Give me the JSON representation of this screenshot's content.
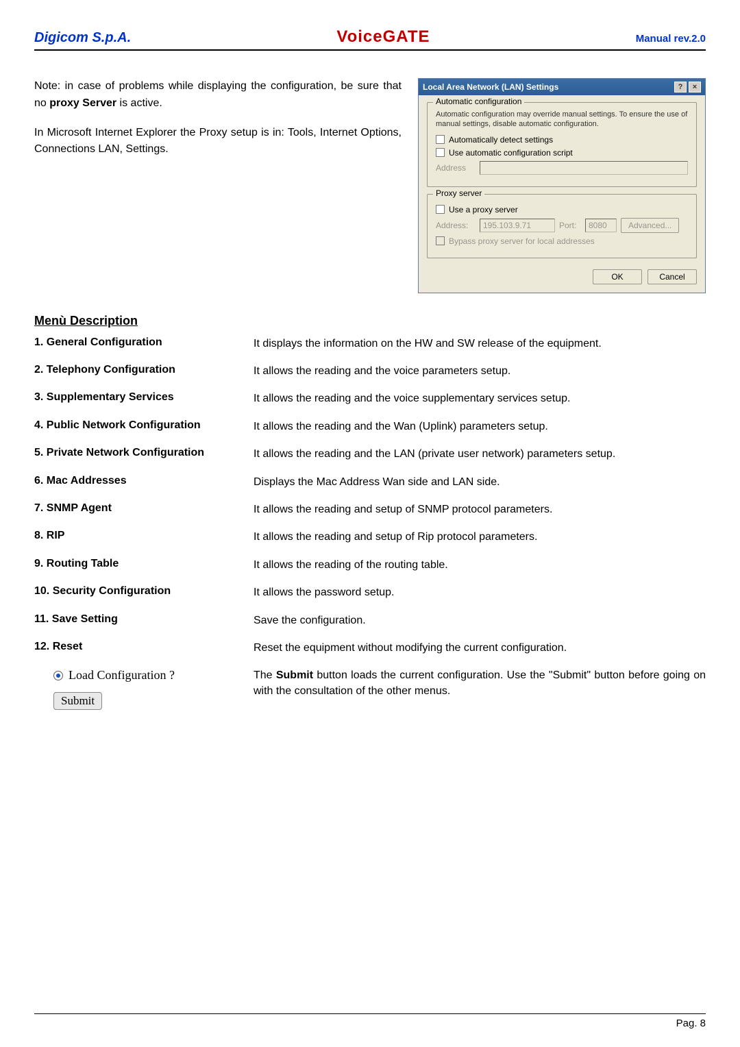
{
  "header": {
    "brand": "Digicom S.p.A.",
    "product": "VoiceGATE",
    "rev": "Manual rev.2.0"
  },
  "intro": {
    "p1_pre": "Note: in case of problems while displaying the configuration, be sure that no ",
    "p1_bold": "proxy Server",
    "p1_post": " is active.",
    "p2": "In Microsoft Internet Explorer the Proxy setup is in: Tools, Internet Options, Connections LAN, Settings."
  },
  "dialog": {
    "title": "Local Area Network (LAN) Settings",
    "help_icon": "?",
    "close_icon": "×",
    "group1": {
      "legend": "Automatic configuration",
      "help": "Automatic configuration may override manual settings.  To ensure the use of manual settings, disable automatic configuration.",
      "cb1": "Automatically detect settings",
      "cb2": "Use automatic configuration script",
      "addr_label": "Address"
    },
    "group2": {
      "legend": "Proxy server",
      "cb1": "Use a proxy server",
      "addr_label": "Address:",
      "addr_value": "195.103.9.71",
      "port_label": "Port:",
      "port_value": "8080",
      "adv": "Advanced...",
      "cb2": "Bypass proxy server for local addresses"
    },
    "ok": "OK",
    "cancel": "Cancel"
  },
  "section_title": "Menù Description",
  "menu": [
    {
      "left": "1. General Configuration",
      "right": "It displays the information on the HW and SW release of the equipment."
    },
    {
      "left": "2. Telephony Configuration",
      "right": "It allows the reading and the voice parameters setup."
    },
    {
      "left": "3. Supplementary Services",
      "right": "It allows the reading and the voice supplementary services setup."
    },
    {
      "left": "4. Public Network Configuration",
      "right": "It allows the reading and the Wan (Uplink) parameters setup."
    },
    {
      "left": "5. Private Network Configuration",
      "right": "It allows the reading and the LAN (private user network) parameters setup."
    },
    {
      "left": "6. Mac Addresses",
      "right": "Displays the Mac Address Wan side and LAN side."
    },
    {
      "left": "7. SNMP Agent",
      "right": "It allows the reading and setup of SNMP protocol parameters."
    },
    {
      "left": "8. RIP",
      "right": "It allows the reading and setup of Rip protocol parameters."
    },
    {
      "left": "9. Routing Table",
      "right": "It allows the reading of the routing table."
    },
    {
      "left": "10. Security Configuration",
      "right": "It allows the password setup."
    },
    {
      "left": "11. Save Setting",
      "right": "Save the configuration."
    },
    {
      "left": "12. Reset",
      "right": "Reset the equipment without modifying the current configuration."
    }
  ],
  "load": {
    "radio_label": "Load Configuration ?",
    "submit": "Submit",
    "right_pre": "The ",
    "right_bold": "Submit",
    "right_post": " button loads the current configuration. Use the \"Submit\" button before going on with the consultation of the other menus."
  },
  "footer": "Pag. 8"
}
